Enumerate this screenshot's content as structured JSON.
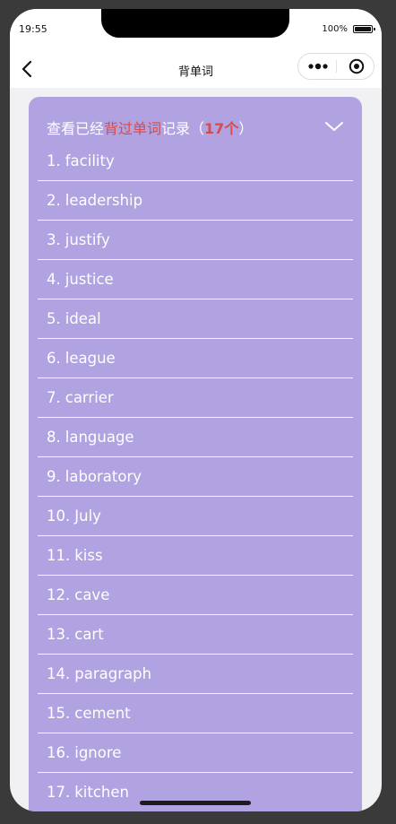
{
  "status_bar": {
    "time": "19:55",
    "battery_text": "100%"
  },
  "nav": {
    "title": "背单词",
    "back_icon": "chevron-left-icon",
    "more_icon": "more-dots-icon",
    "close_icon": "target-circle-icon"
  },
  "panel": {
    "header_prefix": "查看已经",
    "header_highlight": "背过单词",
    "header_middle": "记录（",
    "header_count": "17个",
    "header_suffix": "）",
    "expand_icon": "chevron-down-icon",
    "background_color": "#b1a2e1",
    "highlight_color": "#d84b4b",
    "words": [
      {
        "num": "1.",
        "word": "facility"
      },
      {
        "num": "2.",
        "word": "leadership"
      },
      {
        "num": "3.",
        "word": "justify"
      },
      {
        "num": "4.",
        "word": "justice"
      },
      {
        "num": "5.",
        "word": "ideal"
      },
      {
        "num": "6.",
        "word": "league"
      },
      {
        "num": "7.",
        "word": "carrier"
      },
      {
        "num": "8.",
        "word": "language"
      },
      {
        "num": "9.",
        "word": "laboratory"
      },
      {
        "num": "10.",
        "word": "July"
      },
      {
        "num": "11.",
        "word": "kiss"
      },
      {
        "num": "12.",
        "word": "cave"
      },
      {
        "num": "13.",
        "word": "cart"
      },
      {
        "num": "14.",
        "word": "paragraph"
      },
      {
        "num": "15.",
        "word": "cement"
      },
      {
        "num": "16.",
        "word": "ignore"
      },
      {
        "num": "17.",
        "word": "kitchen"
      }
    ]
  }
}
